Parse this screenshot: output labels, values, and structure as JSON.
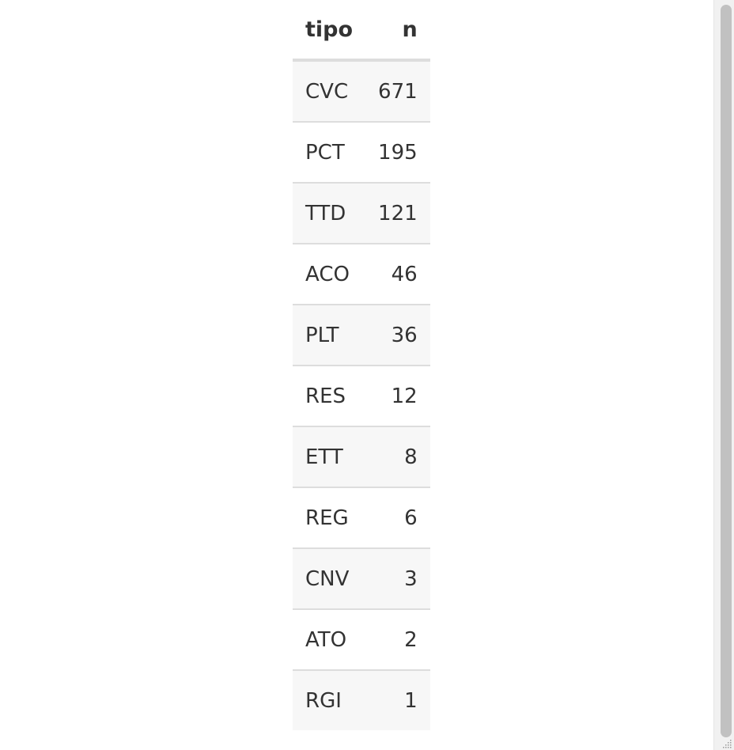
{
  "table": {
    "headers": {
      "tipo": "tipo",
      "n": "n"
    },
    "rows": [
      {
        "tipo": "CVC",
        "n": "671"
      },
      {
        "tipo": "PCT",
        "n": "195"
      },
      {
        "tipo": "TTD",
        "n": "121"
      },
      {
        "tipo": "ACO",
        "n": "46"
      },
      {
        "tipo": "PLT",
        "n": "36"
      },
      {
        "tipo": "RES",
        "n": "12"
      },
      {
        "tipo": "ETT",
        "n": "8"
      },
      {
        "tipo": "REG",
        "n": "6"
      },
      {
        "tipo": "CNV",
        "n": "3"
      },
      {
        "tipo": "ATO",
        "n": "2"
      },
      {
        "tipo": "RGI",
        "n": "1"
      }
    ]
  },
  "icons": {
    "resize": "resize-grip-icon"
  }
}
